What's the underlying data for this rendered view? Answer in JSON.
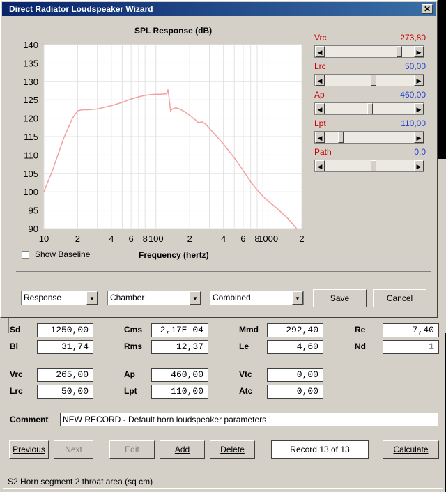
{
  "dialog": {
    "title": "Direct Radiator Loudspeaker Wizard",
    "close_glyph": "✕"
  },
  "chart_data": {
    "type": "line",
    "title": "SPL Response (dB)",
    "xlabel": "Frequency (hertz)",
    "ylabel": "",
    "x_scale": "log",
    "xlim": [
      10,
      2000
    ],
    "ylim": [
      90,
      140
    ],
    "grid": true,
    "y_ticks": [
      "140",
      "135",
      "130",
      "125",
      "120",
      "115",
      "110",
      "105",
      "100",
      "95",
      "90"
    ],
    "x_ticks": [
      {
        "value": 10,
        "label": "10"
      },
      {
        "value": 20,
        "label": "2"
      },
      {
        "value": 40,
        "label": "4"
      },
      {
        "value": 60,
        "label": "6"
      },
      {
        "value": 80,
        "label": "8"
      },
      {
        "value": 100,
        "label": "100"
      },
      {
        "value": 200,
        "label": "2"
      },
      {
        "value": 400,
        "label": "4"
      },
      {
        "value": 600,
        "label": "6"
      },
      {
        "value": 800,
        "label": "8"
      },
      {
        "value": 1000,
        "label": "1000"
      },
      {
        "value": 2000,
        "label": "2"
      }
    ],
    "series": [
      {
        "color": "#f4a0a0",
        "x": [
          10,
          12,
          15,
          18,
          20,
          22,
          25,
          30,
          40,
          50,
          60,
          70,
          80,
          90,
          100,
          110,
          120,
          125,
          128,
          130,
          135,
          140,
          150,
          160,
          180,
          200,
          220,
          240,
          260,
          280,
          300,
          350,
          400,
          500,
          600,
          700,
          800,
          900,
          1000,
          1200,
          1500,
          1800
        ],
        "y": [
          100,
          106,
          114.5,
          120,
          122,
          122.3,
          122.3,
          122.5,
          123.4,
          124.3,
          125.2,
          125.8,
          126.2,
          126.4,
          126.5,
          126.5,
          126.6,
          126.6,
          127.8,
          126.3,
          122,
          122.5,
          122.8,
          122.6,
          121.8,
          120.8,
          119.8,
          118.8,
          119,
          118.3,
          117.2,
          115,
          113,
          109.2,
          105.8,
          102.7,
          100.5,
          98.8,
          97.5,
          95.5,
          92.8,
          90
        ]
      }
    ]
  },
  "sliders": [
    {
      "label": "Vrc",
      "value": "273,80",
      "label_color": "#cc0000",
      "value_color": "#cc0000",
      "thumb_fraction": 0.86
    },
    {
      "label": "Lrc",
      "value": "50,00",
      "label_color": "#cc0000",
      "value_color": "#1f3fd6",
      "thumb_fraction": 0.55
    },
    {
      "label": "Ap",
      "value": "460,00",
      "label_color": "#cc0000",
      "value_color": "#1f3fd6",
      "thumb_fraction": 0.51
    },
    {
      "label": "Lpt",
      "value": "110,00",
      "label_color": "#cc0000",
      "value_color": "#1f3fd6",
      "thumb_fraction": 0.16
    },
    {
      "label": "Path",
      "value": "0,0",
      "label_color": "#cc0000",
      "value_color": "#1f3fd6",
      "thumb_fraction": 0.55
    }
  ],
  "show_baseline_label": "Show Baseline",
  "combos": [
    {
      "value": "Response"
    },
    {
      "value": "Chamber"
    },
    {
      "value": "Combined"
    }
  ],
  "dialog_buttons": {
    "save": "Save",
    "cancel": "Cancel"
  },
  "params": {
    "Sd": {
      "label": "Sd",
      "value": "1250,00"
    },
    "Cms": {
      "label": "Cms",
      "value": "2,17E-04"
    },
    "Mmd": {
      "label": "Mmd",
      "value": "292,40"
    },
    "Re": {
      "label": "Re",
      "value": "7,40"
    },
    "Bl": {
      "label": "Bl",
      "value": "31,74"
    },
    "Rms": {
      "label": "Rms",
      "value": "12,37"
    },
    "Le": {
      "label": "Le",
      "value": "4,60"
    },
    "Nd": {
      "label": "Nd",
      "value": "1"
    },
    "Vrc": {
      "label": "Vrc",
      "value": "265,00"
    },
    "Ap": {
      "label": "Ap",
      "value": "460,00"
    },
    "Vtc": {
      "label": "Vtc",
      "value": "0,00"
    },
    "Lrc": {
      "label": "Lrc",
      "value": "50,00"
    },
    "Lpt": {
      "label": "Lpt",
      "value": "110,00"
    },
    "Atc": {
      "label": "Atc",
      "value": "0,00"
    }
  },
  "comment": {
    "label": "Comment",
    "value": "NEW RECORD - Default horn loudspeaker parameters"
  },
  "nav": {
    "previous": "Previous",
    "next": "Next",
    "edit": "Edit",
    "add": "Add",
    "delete": "Delete",
    "record": "Record 13 of 13",
    "calculate": "Calculate"
  },
  "status": "S2   Horn segment 2 throat area  (sq cm)"
}
